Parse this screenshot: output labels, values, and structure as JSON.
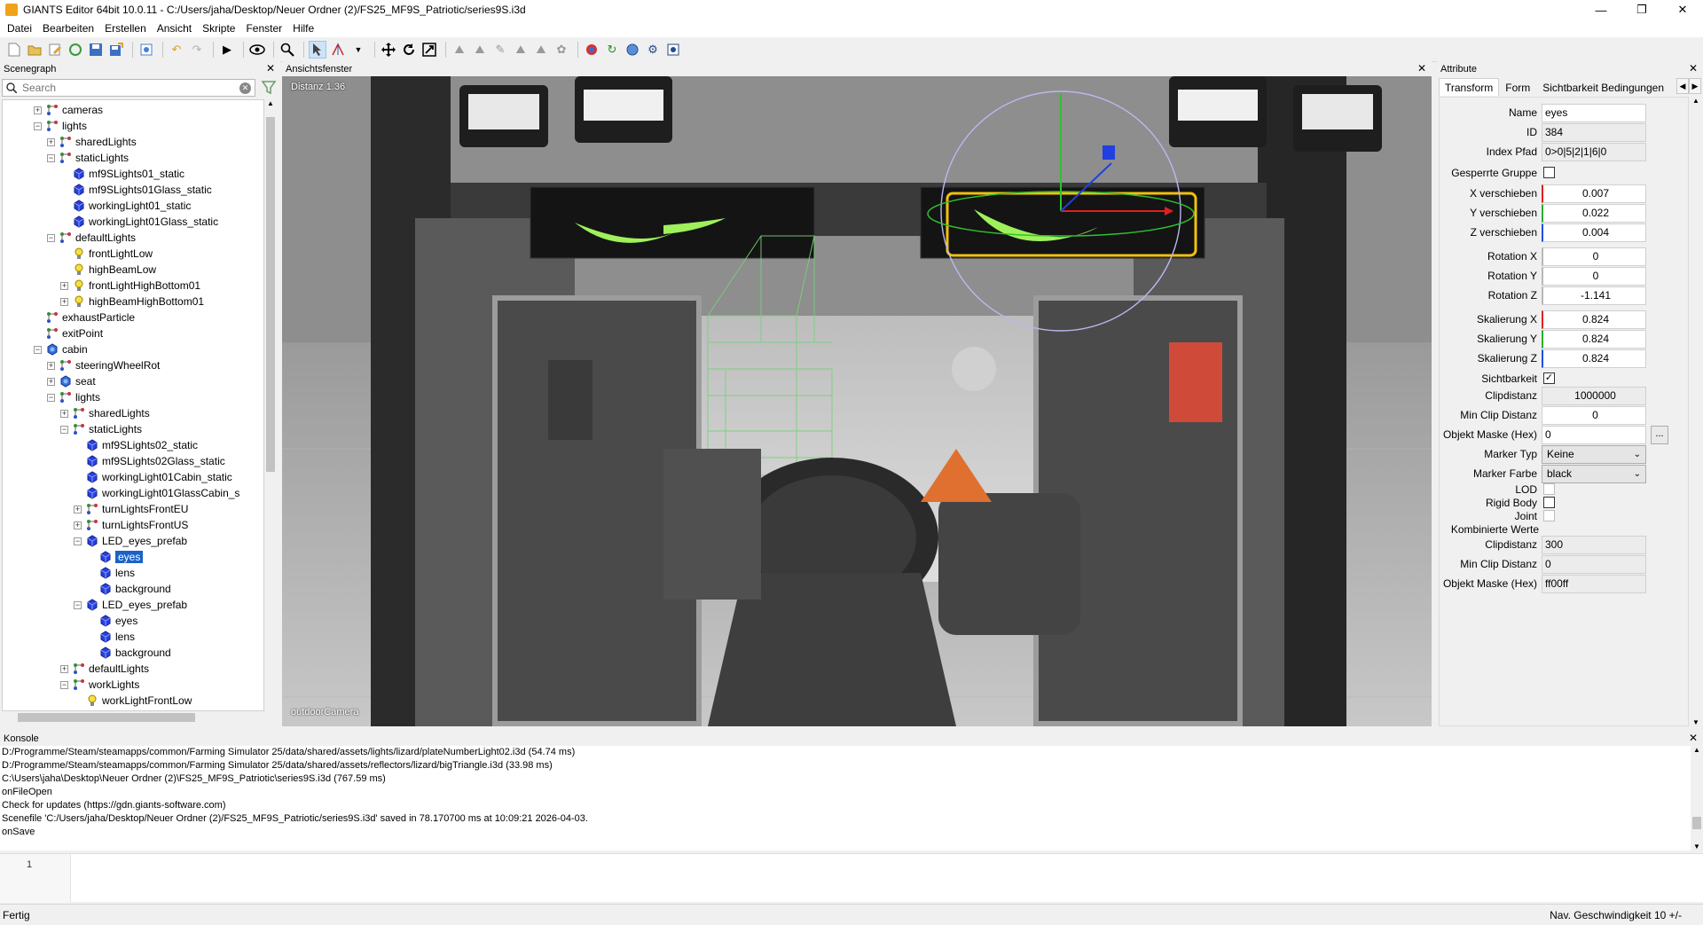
{
  "window": {
    "title": "GIANTS Editor 64bit 10.0.11 - C:/Users/jaha/Desktop/Neuer Ordner (2)/FS25_MF9S_Patriotic/series9S.i3d",
    "minimize": "—",
    "maximize": "❐",
    "close": "✕"
  },
  "menu": [
    "Datei",
    "Bearbeiten",
    "Erstellen",
    "Ansicht",
    "Skripte",
    "Fenster",
    "Hilfe"
  ],
  "scenegraph": {
    "title": "Scenegraph",
    "search_placeholder": "Search",
    "items": [
      {
        "label": "cameras",
        "depth": 1,
        "expander": "+",
        "icon": "transform-group-icon"
      },
      {
        "label": "lights",
        "depth": 1,
        "expander": "−",
        "icon": "transform-group-icon"
      },
      {
        "label": "sharedLights",
        "depth": 2,
        "expander": "+",
        "icon": "transform-group-icon"
      },
      {
        "label": "staticLights",
        "depth": 2,
        "expander": "−",
        "icon": "transform-group-icon"
      },
      {
        "label": "mf9SLights01_static",
        "depth": 3,
        "expander": "",
        "icon": "shape-cube-icon"
      },
      {
        "label": "mf9SLights01Glass_static",
        "depth": 3,
        "expander": "",
        "icon": "shape-cube-icon"
      },
      {
        "label": "workingLight01_static",
        "depth": 3,
        "expander": "",
        "icon": "shape-cube-icon"
      },
      {
        "label": "workingLight01Glass_static",
        "depth": 3,
        "expander": "",
        "icon": "shape-cube-icon"
      },
      {
        "label": "defaultLights",
        "depth": 2,
        "expander": "−",
        "icon": "transform-group-icon"
      },
      {
        "label": "frontLightLow",
        "depth": 3,
        "expander": "",
        "icon": "light-bulb-icon"
      },
      {
        "label": "highBeamLow",
        "depth": 3,
        "expander": "",
        "icon": "light-bulb-icon"
      },
      {
        "label": "frontLightHighBottom01",
        "depth": 3,
        "expander": "+",
        "icon": "light-bulb-icon"
      },
      {
        "label": "highBeamHighBottom01",
        "depth": 3,
        "expander": "+",
        "icon": "light-bulb-icon"
      },
      {
        "label": "exhaustParticle",
        "depth": 1,
        "expander": "",
        "icon": "transform-group-icon"
      },
      {
        "label": "exitPoint",
        "depth": 1,
        "expander": "",
        "icon": "transform-group-icon"
      },
      {
        "label": "cabin",
        "depth": 1,
        "expander": "−",
        "icon": "shape-mesh-icon"
      },
      {
        "label": "steeringWheelRot",
        "depth": 2,
        "expander": "+",
        "icon": "transform-group-icon"
      },
      {
        "label": "seat",
        "depth": 2,
        "expander": "+",
        "icon": "shape-mesh-icon"
      },
      {
        "label": "lights",
        "depth": 2,
        "expander": "−",
        "icon": "transform-group-icon"
      },
      {
        "label": "sharedLights",
        "depth": 3,
        "expander": "+",
        "icon": "transform-group-icon"
      },
      {
        "label": "staticLights",
        "depth": 3,
        "expander": "−",
        "icon": "transform-group-icon"
      },
      {
        "label": "mf9SLights02_static",
        "depth": 4,
        "expander": "",
        "icon": "shape-cube-icon"
      },
      {
        "label": "mf9SLights02Glass_static",
        "depth": 4,
        "expander": "",
        "icon": "shape-cube-icon"
      },
      {
        "label": "workingLight01Cabin_static",
        "depth": 4,
        "expander": "",
        "icon": "shape-cube-icon"
      },
      {
        "label": "workingLight01GlassCabin_s",
        "depth": 4,
        "expander": "",
        "icon": "shape-cube-icon"
      },
      {
        "label": "turnLightsFrontEU",
        "depth": 4,
        "expander": "+",
        "icon": "transform-group-icon"
      },
      {
        "label": "turnLightsFrontUS",
        "depth": 4,
        "expander": "+",
        "icon": "transform-group-icon"
      },
      {
        "label": "LED_eyes_prefab",
        "depth": 4,
        "expander": "−",
        "icon": "shape-cube-icon"
      },
      {
        "label": "eyes",
        "depth": 5,
        "expander": "",
        "icon": "shape-cube-icon",
        "selected": true
      },
      {
        "label": "lens",
        "depth": 5,
        "expander": "",
        "icon": "shape-cube-icon"
      },
      {
        "label": "background",
        "depth": 5,
        "expander": "",
        "icon": "shape-cube-icon"
      },
      {
        "label": "LED_eyes_prefab",
        "depth": 4,
        "expander": "−",
        "icon": "shape-cube-icon"
      },
      {
        "label": "eyes",
        "depth": 5,
        "expander": "",
        "icon": "shape-cube-icon"
      },
      {
        "label": "lens",
        "depth": 5,
        "expander": "",
        "icon": "shape-cube-icon"
      },
      {
        "label": "background",
        "depth": 5,
        "expander": "",
        "icon": "shape-cube-icon"
      },
      {
        "label": "defaultLights",
        "depth": 3,
        "expander": "+",
        "icon": "transform-group-icon"
      },
      {
        "label": "workLights",
        "depth": 3,
        "expander": "−",
        "icon": "transform-group-icon"
      },
      {
        "label": "workLightFrontLow",
        "depth": 4,
        "expander": "",
        "icon": "light-bulb-icon"
      }
    ]
  },
  "viewport": {
    "title": "Ansichtsfenster",
    "distance": "Distanz 1.36",
    "camera": "outdoorCamera"
  },
  "attributes": {
    "title": "Attribute",
    "tabs": [
      "Transform",
      "Form",
      "Sichtbarkeit Bedingungen"
    ],
    "active_tab": "Transform",
    "name_label": "Name",
    "name_value": "eyes",
    "id_label": "ID",
    "id_value": "384",
    "index_label": "Index Pfad",
    "index_value": "0>0|5|2|1|6|0",
    "locked_label": "Gesperrte Gruppe",
    "tx_label": "X verschieben",
    "tx": "0.007",
    "ty_label": "Y verschieben",
    "ty": "0.022",
    "tz_label": "Z verschieben",
    "tz": "0.004",
    "rx_label": "Rotation X",
    "rx": "0",
    "ry_label": "Rotation Y",
    "ry": "0",
    "rz_label": "Rotation Z",
    "rz": "-1.141",
    "sx_label": "Skalierung X",
    "sx": "0.824",
    "sy_label": "Skalierung Y",
    "sy": "0.824",
    "sz_label": "Skalierung Z",
    "sz": "0.824",
    "visibility_label": "Sichtbarkeit",
    "visibility_check": "✓",
    "clip_label": "Clipdistanz",
    "clip": "1000000",
    "minclip_label": "Min Clip Distanz",
    "minclip": "0",
    "mask_label": "Objekt Maske (Hex)",
    "mask": "0",
    "mask_button": "...",
    "marker_type_label": "Marker Typ",
    "marker_type": "Keine",
    "marker_color_label": "Marker Farbe",
    "marker_color": "black",
    "lod_label": "LOD",
    "rigid_label": "Rigid Body",
    "joint_label": "Joint",
    "combined_label": "Kombinierte Werte",
    "c_clip_label": "Clipdistanz",
    "c_clip": "300",
    "c_minclip_label": "Min Clip Distanz",
    "c_minclip": "0",
    "c_mask_label": "Objekt Maske (Hex)",
    "c_mask": "ff00ff"
  },
  "console": {
    "title": "Konsole",
    "lines": [
      "D:/Programme/Steam/steamapps/common/Farming Simulator 25/data/shared/assets/lights/lizard/plateNumberLight02.i3d (54.74 ms)",
      "D:/Programme/Steam/steamapps/common/Farming Simulator 25/data/shared/assets/reflectors/lizard/bigTriangle.i3d (33.98 ms)",
      "C:\\Users\\jaha\\Desktop\\Neuer Ordner (2)\\FS25_MF9S_Patriotic\\series9S.i3d (767.59 ms)",
      "onFileOpen",
      "Check for updates (https://gdn.giants-software.com)",
      "Scenefile 'C:/Users/jaha/Desktop/Neuer Ordner (2)/FS25_MF9S_Patriotic/series9S.i3d' saved in 78.170700 ms at 10:09:21 2026-04-03.",
      "onSave"
    ],
    "line_number": "1"
  },
  "status": {
    "left": "Fertig",
    "right": "Nav. Geschwindigkeit 10 +/-"
  },
  "colors": {
    "selection": "#1c62c6",
    "led_green": "#9ff05a",
    "gizmo_yellow": "#f0c010"
  }
}
